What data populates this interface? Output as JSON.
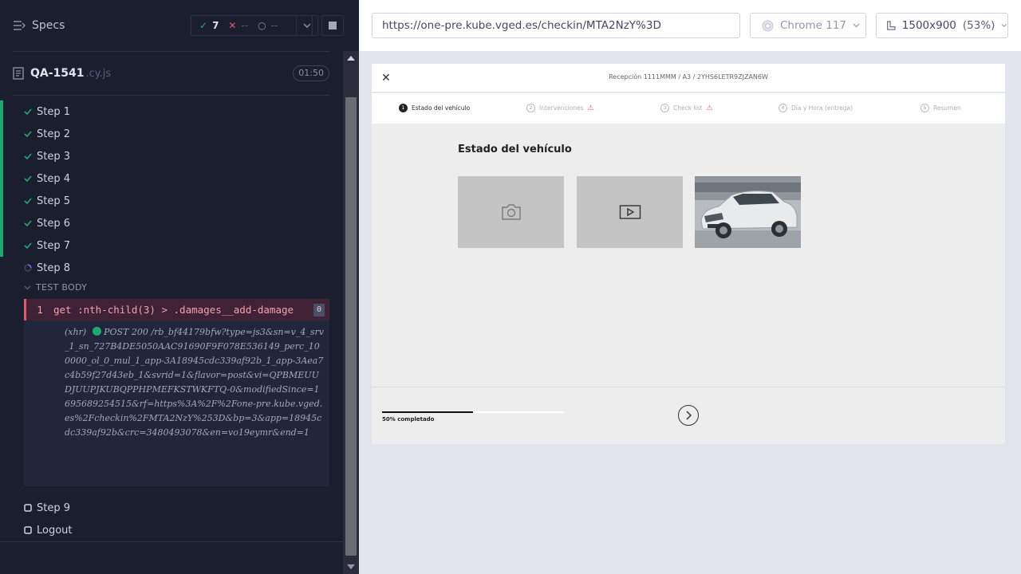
{
  "runner": {
    "specs_label": "Specs",
    "stats": {
      "passed": "7",
      "failed": "--",
      "pending": "--"
    },
    "spec": {
      "name": "QA-1541",
      "ext": ".cy.js",
      "duration": "01:50"
    },
    "steps": [
      {
        "label": "Step 1",
        "state": "passed"
      },
      {
        "label": "Step 2",
        "state": "passed"
      },
      {
        "label": "Step 3",
        "state": "passed"
      },
      {
        "label": "Step 4",
        "state": "passed"
      },
      {
        "label": "Step 5",
        "state": "passed"
      },
      {
        "label": "Step 6",
        "state": "passed"
      },
      {
        "label": "Step 7",
        "state": "passed"
      },
      {
        "label": "Step 8",
        "state": "running"
      }
    ],
    "test_body_label": "TEST BODY",
    "command": {
      "number": "1",
      "text": "get  :nth-child(3) > .damages__add-damage",
      "count": "0"
    },
    "xhr": {
      "prefix": "(xhr)",
      "request": "POST 200 /rb_bf44179bfw?type=js3&sn=v_4_srv_1_sn_727B4DE5050AAC91690F9F078E536149_perc_100000_ol_0_mul_1_app-3A18945cdc339af92b_1_app-3Aea7c4b59f27d43eb_1&svrid=1&flavor=post&vi=QPBMEUUDJUUPJKUBQPPHPMEFKSTWKFTQ-0&modifiedSince=1695689254515&rf=https%3A%2F%2Fone-pre.kube.vged.es%2Fcheckin%2FMTA2NzY%253D&bp=3&app=18945cdc339af92b&crc=3480493078&en=vo19eymr&end=1"
    },
    "later_steps": [
      {
        "label": "Step 9",
        "state": "pending"
      },
      {
        "label": "Logout",
        "state": "pending"
      }
    ]
  },
  "browser_bar": {
    "url": "https://one-pre.kube.vged.es/checkin/MTA2NzY%3D",
    "browser": "Chrome 117",
    "viewport": "1500x900",
    "scale": "(53%)"
  },
  "app": {
    "title": "Recepción 1111MMM / A3 / 2YHS6LETR9ZJZAN6W",
    "wizard_steps": [
      {
        "num": "1",
        "label": "Estado del vehículo",
        "active": true,
        "warn": false
      },
      {
        "num": "2",
        "label": "Intervenciones",
        "active": false,
        "warn": true
      },
      {
        "num": "3",
        "label": "Check list",
        "active": false,
        "warn": true
      },
      {
        "num": "4",
        "label": "Día y Hora (entrega)",
        "active": false,
        "warn": false
      },
      {
        "num": "5",
        "label": "Resumen",
        "active": false,
        "warn": false
      }
    ],
    "section_title": "Estado del vehículo",
    "progress": {
      "percent": 50,
      "label": "50% completado"
    }
  },
  "colors": {
    "pass": "#1fa971",
    "fail": "#e45770",
    "running": "#6d6ef0"
  }
}
